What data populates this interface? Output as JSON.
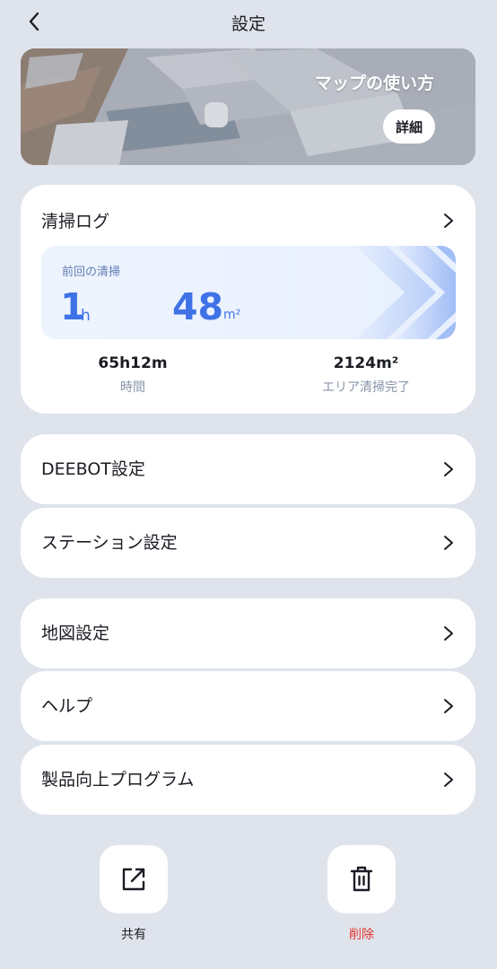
{
  "header": {
    "title": "設定"
  },
  "banner": {
    "title": "マップの使い方",
    "button_label": "詳細"
  },
  "cleaning_log": {
    "title": "清掃ログ",
    "last_clean_label": "前回の清掃",
    "last_time_value": "1",
    "last_time_unit": "h",
    "last_area_value": "48",
    "last_area_unit": "m²",
    "total_time_value": "65h12m",
    "total_time_label": "時間",
    "total_area_value": "2124m²",
    "total_area_label": "エリア清掃完了"
  },
  "menu": {
    "deebot": "DEEBOT設定",
    "station": "ステーション設定",
    "map": "地図設定",
    "help": "ヘルプ",
    "improvement": "製品向上プログラム"
  },
  "actions": {
    "share_label": "共有",
    "delete_label": "削除"
  },
  "colors": {
    "accent": "#3f72e6",
    "danger": "#e5372f",
    "background": "#dfe3ec"
  }
}
